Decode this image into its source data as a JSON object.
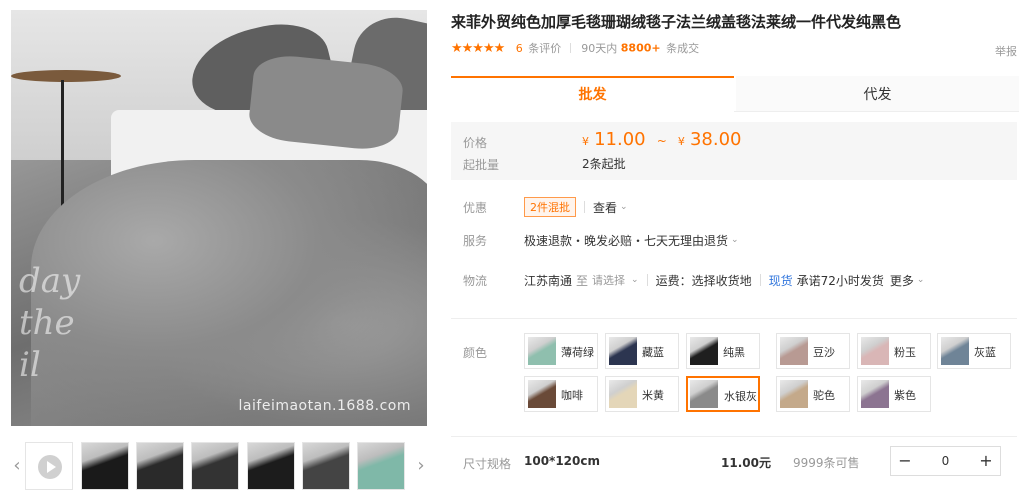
{
  "product": {
    "title": "来菲外贸纯色加厚毛毯珊瑚绒毯子法兰绒盖毯法莱绒一件代发纯黑色",
    "rating_stars": 5,
    "review_count": "6",
    "review_label": "条评价",
    "days_label": "90天内",
    "deals_count": "8800+",
    "deals_label": "条成交",
    "report_label": "举报",
    "watermark": "laifeimaotan.1688.com",
    "wall_text": "day\nthe\nil"
  },
  "tabs": [
    {
      "label": "批发"
    },
    {
      "label": "代发"
    }
  ],
  "price": {
    "price_label": "价格",
    "currency": "¥",
    "min": "11.00",
    "tilde": "~",
    "max": "38.00",
    "moq_label": "起批量",
    "moq_value": "2条起批"
  },
  "promo": {
    "label": "优惠",
    "badge": "2件混批",
    "view_label": "查看"
  },
  "service": {
    "label": "服务",
    "value": "极速退款・晚发必赔・七天无理由退货"
  },
  "logistics": {
    "label": "物流",
    "origin": "江苏南通",
    "to": "至",
    "select": "请选择",
    "freight": "运费：选择收货地",
    "stock_tag": "现货",
    "promise": "承诺72小时发货",
    "more": "更多"
  },
  "colors": {
    "label": "颜色",
    "options": [
      {
        "name": "薄荷绿",
        "color": "#8fbfae"
      },
      {
        "name": "藏蓝",
        "color": "#2c3550"
      },
      {
        "name": "纯黑",
        "color": "#1f1f1f"
      },
      {
        "name": "豆沙",
        "color": "#b89a93"
      },
      {
        "name": "粉玉",
        "color": "#d9b6b6"
      },
      {
        "name": "灰蓝",
        "color": "#6f8497"
      },
      {
        "name": "咖啡",
        "color": "#6a4a38"
      },
      {
        "name": "米黄",
        "color": "#e4d6b8"
      },
      {
        "name": "水银灰",
        "color": "#8a8a8a"
      },
      {
        "name": "驼色",
        "color": "#c4a98a"
      },
      {
        "name": "紫色",
        "color": "#8c7491"
      }
    ],
    "selected": "水银灰"
  },
  "sizes": {
    "label": "尺寸规格",
    "spec": "100*120cm",
    "price": "11.00元",
    "stock": "9999条可售",
    "qty": "0",
    "minus": "−",
    "plus": "+"
  },
  "gallery": {
    "prev": "‹",
    "next": "›",
    "thumb_colors": [
      "#1a1a1a",
      "#2a2a2a",
      "#333333",
      "#1c1c1c",
      "#444444",
      "#7fb8a8",
      "#222222"
    ]
  }
}
